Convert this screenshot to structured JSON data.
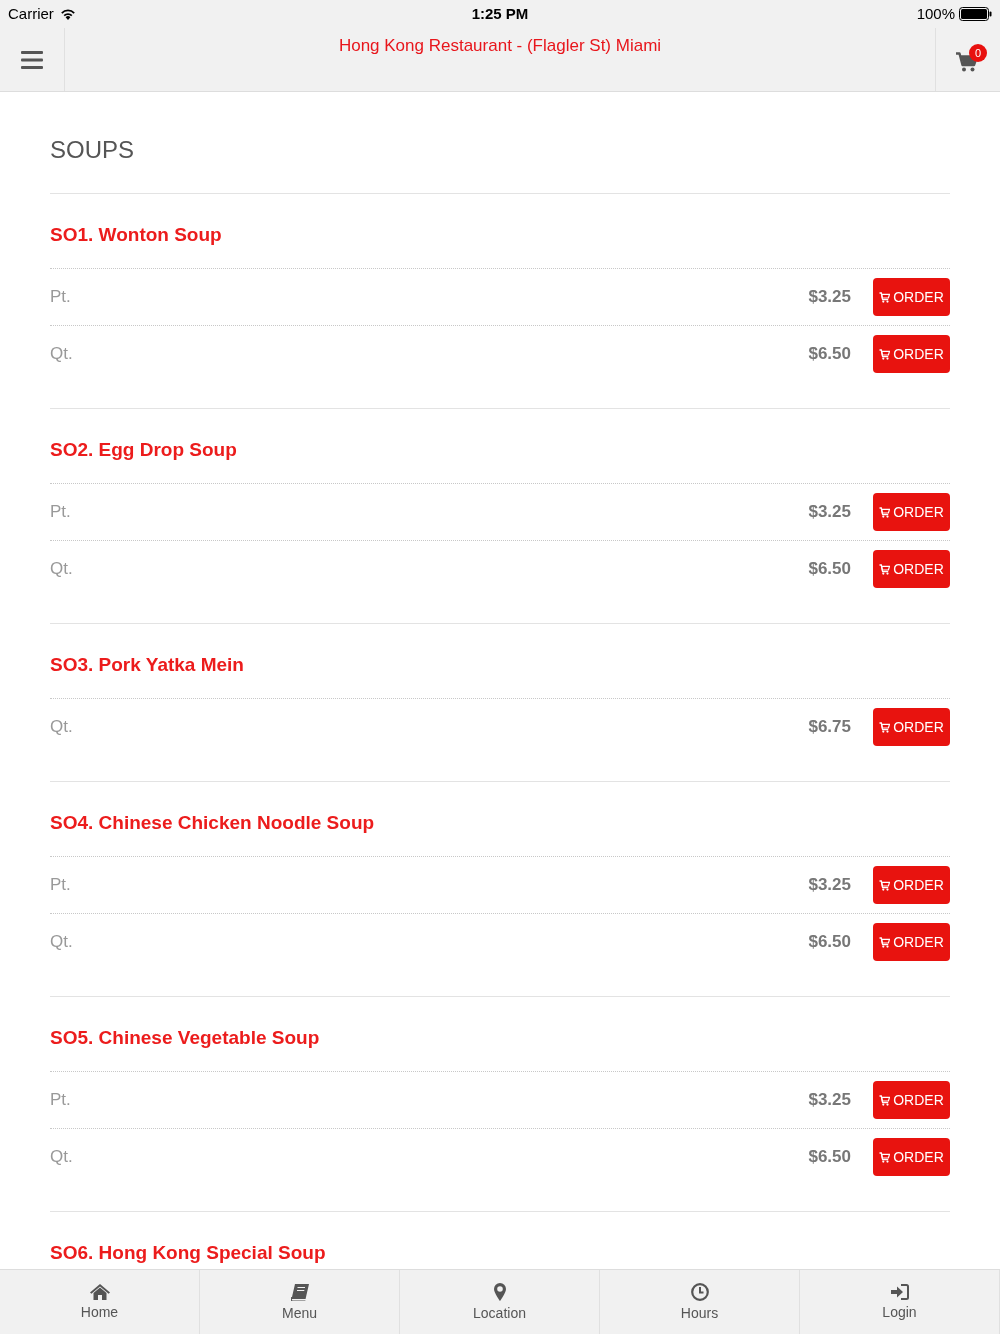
{
  "status_bar": {
    "carrier": "Carrier",
    "time": "1:25 PM",
    "battery": "100%"
  },
  "header": {
    "title": "Hong Kong Restaurant - (Flagler St) Miami",
    "cart_count": "0"
  },
  "section": {
    "title": "SOUPS"
  },
  "items": [
    {
      "name": "SO1. Wonton Soup",
      "options": [
        {
          "size": "Pt.",
          "price": "$3.25",
          "button": "ORDER"
        },
        {
          "size": "Qt.",
          "price": "$6.50",
          "button": "ORDER"
        }
      ]
    },
    {
      "name": "SO2. Egg Drop Soup",
      "options": [
        {
          "size": "Pt.",
          "price": "$3.25",
          "button": "ORDER"
        },
        {
          "size": "Qt.",
          "price": "$6.50",
          "button": "ORDER"
        }
      ]
    },
    {
      "name": "SO3. Pork Yatka Mein",
      "options": [
        {
          "size": "Qt.",
          "price": "$6.75",
          "button": "ORDER"
        }
      ]
    },
    {
      "name": "SO4. Chinese Chicken Noodle Soup",
      "options": [
        {
          "size": "Pt.",
          "price": "$3.25",
          "button": "ORDER"
        },
        {
          "size": "Qt.",
          "price": "$6.50",
          "button": "ORDER"
        }
      ]
    },
    {
      "name": "SO5. Chinese Vegetable Soup",
      "options": [
        {
          "size": "Pt.",
          "price": "$3.25",
          "button": "ORDER"
        },
        {
          "size": "Qt.",
          "price": "$6.50",
          "button": "ORDER"
        }
      ]
    },
    {
      "name": "SO6. Hong Kong Special Soup"
    }
  ],
  "tab_bar": [
    {
      "label": "Home"
    },
    {
      "label": "Menu"
    },
    {
      "label": "Location"
    },
    {
      "label": "Hours"
    },
    {
      "label": "Login"
    }
  ]
}
